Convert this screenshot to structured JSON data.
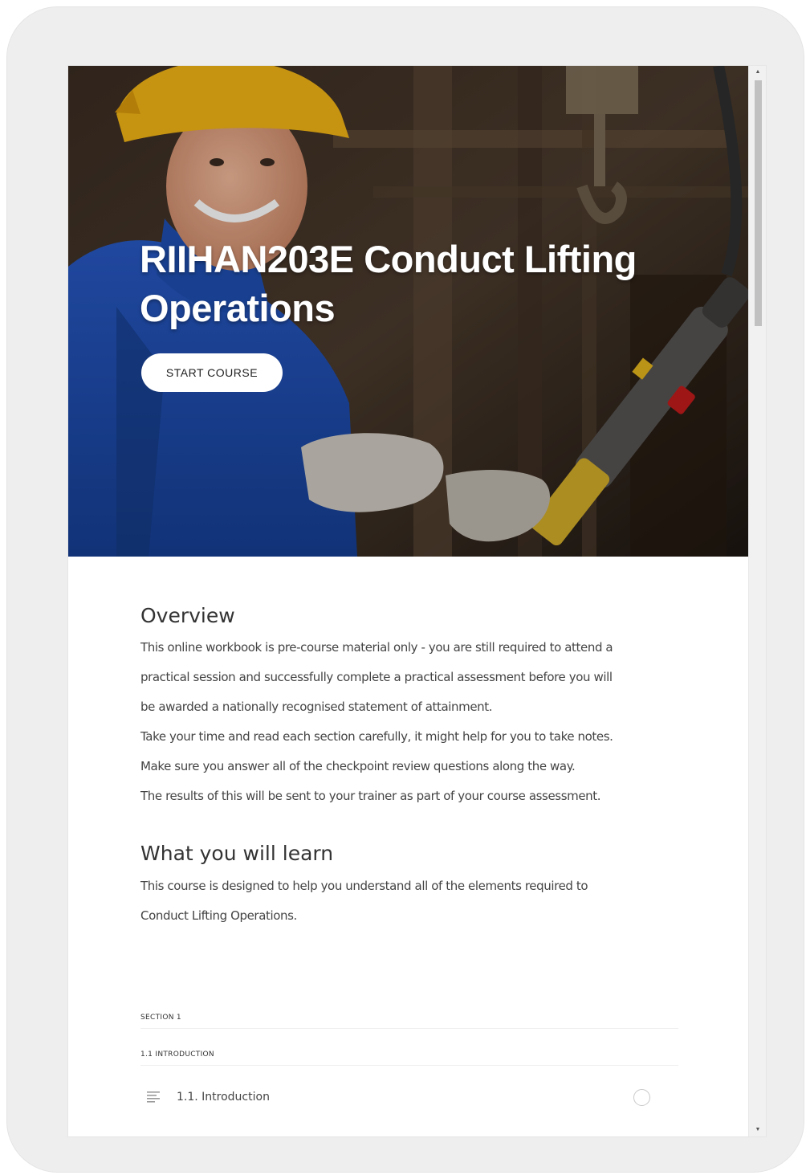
{
  "course": {
    "title_line1": "RIIHAN203E Conduct Lifting",
    "title_line2": "Operations",
    "start_label": "START COURSE"
  },
  "overview": {
    "heading": "Overview",
    "lines": [
      "This online workbook is pre-course material only - you are still required to attend a",
      "practical session and successfully complete a practical assessment before you will",
      "be awarded a nationally recognised statement of attainment.",
      "Take your time and read each section carefully, it might help for you to take notes.",
      "Make sure you answer all of the checkpoint review questions along the way.",
      "The results of this will be sent to your trainer as part of your course assessment."
    ]
  },
  "learn": {
    "heading": "What you will learn",
    "lines": [
      "This course is designed to help you understand all of the elements required to",
      "Conduct Lifting Operations."
    ]
  },
  "outline": {
    "section_label": "SECTION 1",
    "subsection_label": "1.1 INTRODUCTION",
    "lesson_title": "1.1. Introduction",
    "lesson_icon": "text-lines-icon",
    "status_icon": "incomplete-circle-icon"
  },
  "scrollbar": {
    "up_icon": "arrow-up-icon",
    "down_icon": "arrow-down-icon"
  },
  "colors": {
    "hero_dark": "#2a221c",
    "hardhat": "#f2b515",
    "overalls": "#1f4fb0",
    "text": "#444444"
  }
}
